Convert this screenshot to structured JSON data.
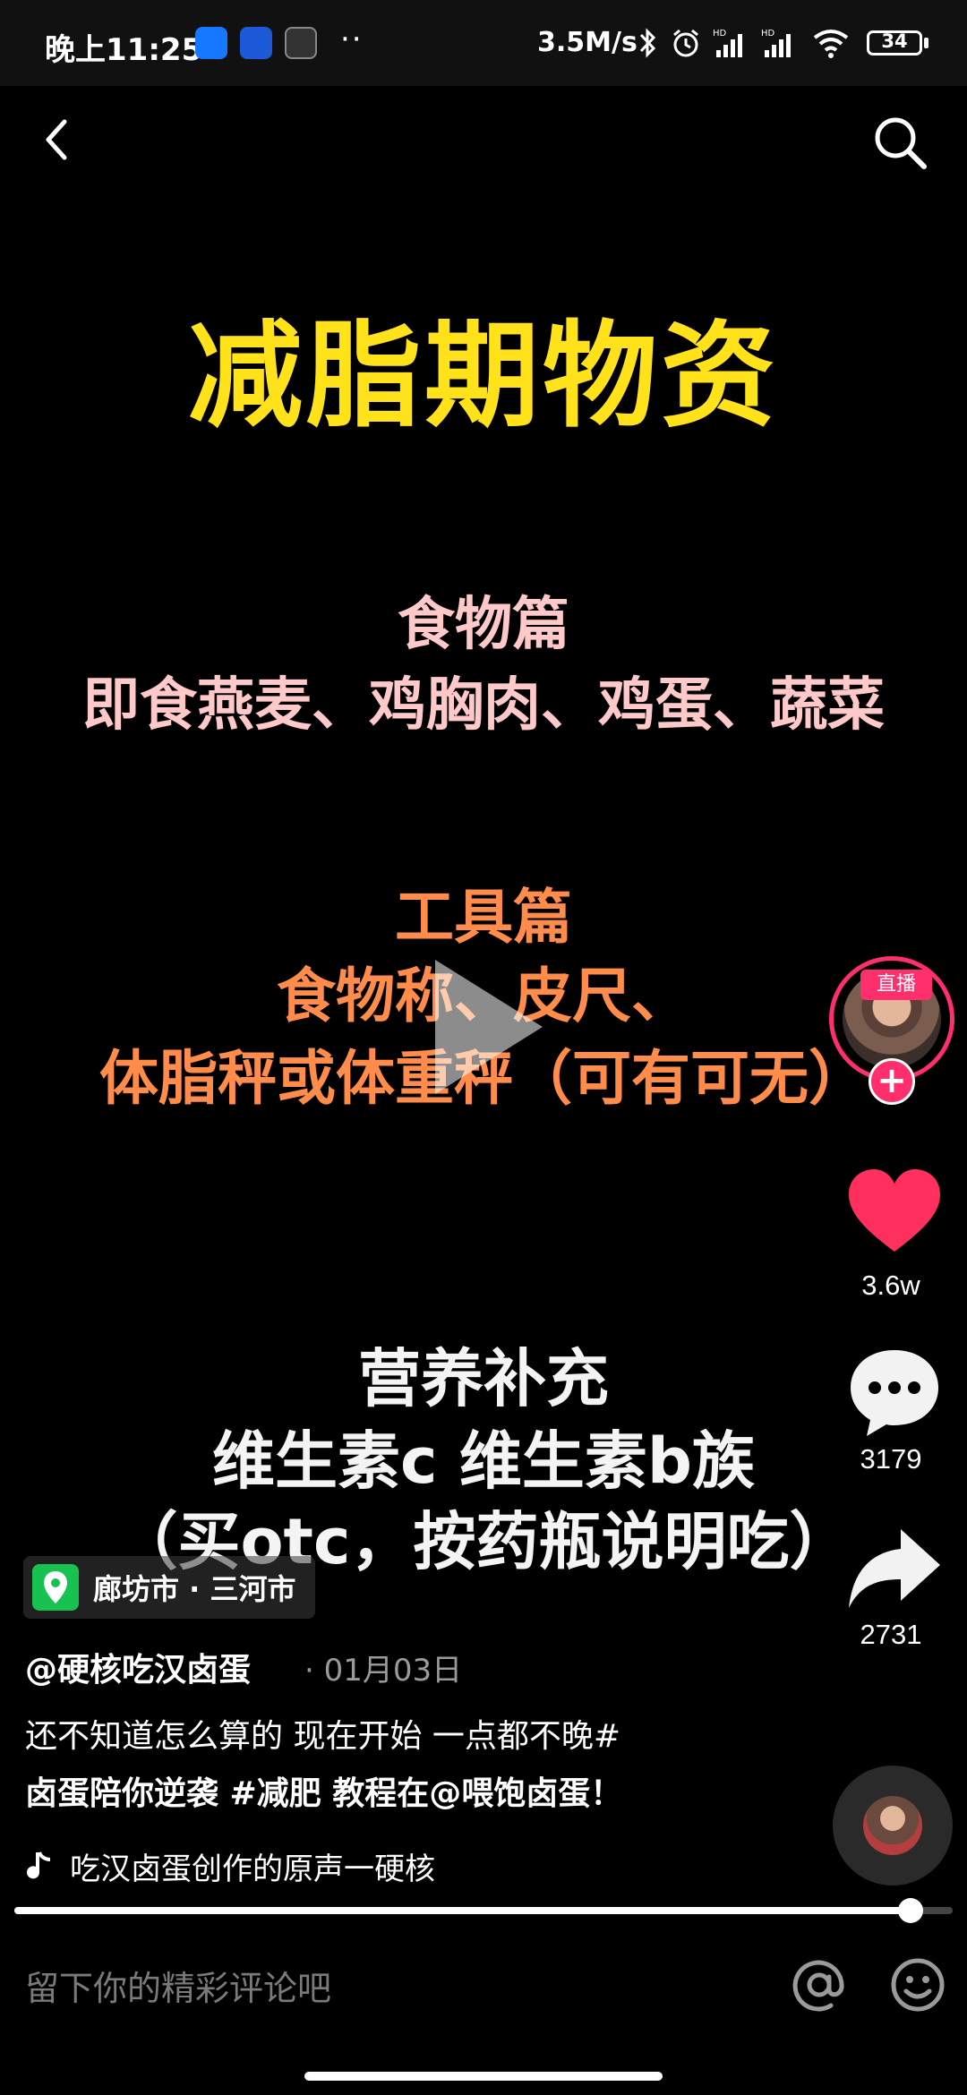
{
  "status_bar": {
    "time": "晚上11:25",
    "dots": "··",
    "speed": "3.5M/s",
    "battery": "34",
    "battery_level": 0.34
  },
  "video": {
    "title": "减脂期物资",
    "food_heading": "食物篇",
    "food_items": "即食燕麦、鸡胸肉、鸡蛋、蔬菜",
    "tools_heading": "工具篇",
    "tools_line1": "食物称、皮尺、",
    "tools_line2": "体脂秤或体重秤（可有可无）",
    "supplement_heading": "营养补充",
    "supplement_line1": "维生素c 维生素b族",
    "supplement_line2": "（买otc，按药瓶说明吃）"
  },
  "sidebar": {
    "live_badge": "直播",
    "follow": "+",
    "like_count": "3.6w",
    "comment_count": "3179",
    "share_count": "2731"
  },
  "caption": {
    "location": "廊坊市 · 三河市",
    "author": "@硬核吃汉卤蛋",
    "date": "· 01月03日",
    "description_line1": "还不知道怎么算的 现在开始 一点都不晚#",
    "description_line2": "卤蛋陪你逆袭 #减肥  教程在@喂饱卤蛋！",
    "music": "吃汉卤蛋创作的原声一硬核"
  },
  "progress": {
    "played_fraction": 0.955
  },
  "comment_bar": {
    "placeholder": "留下你的精彩评论吧"
  },
  "colors": {
    "accent": "#ff2f6d",
    "title_yellow": "#ffe21a",
    "food_pink": "#ffc9c9",
    "tools_orange": "#ff8c4a",
    "location_green": "#18c251"
  },
  "icons": [
    "back-icon",
    "search-icon",
    "play-icon",
    "heart-icon",
    "comment-icon",
    "share-icon",
    "location-pin-icon",
    "music-note-icon",
    "at-icon",
    "emoji-icon"
  ]
}
